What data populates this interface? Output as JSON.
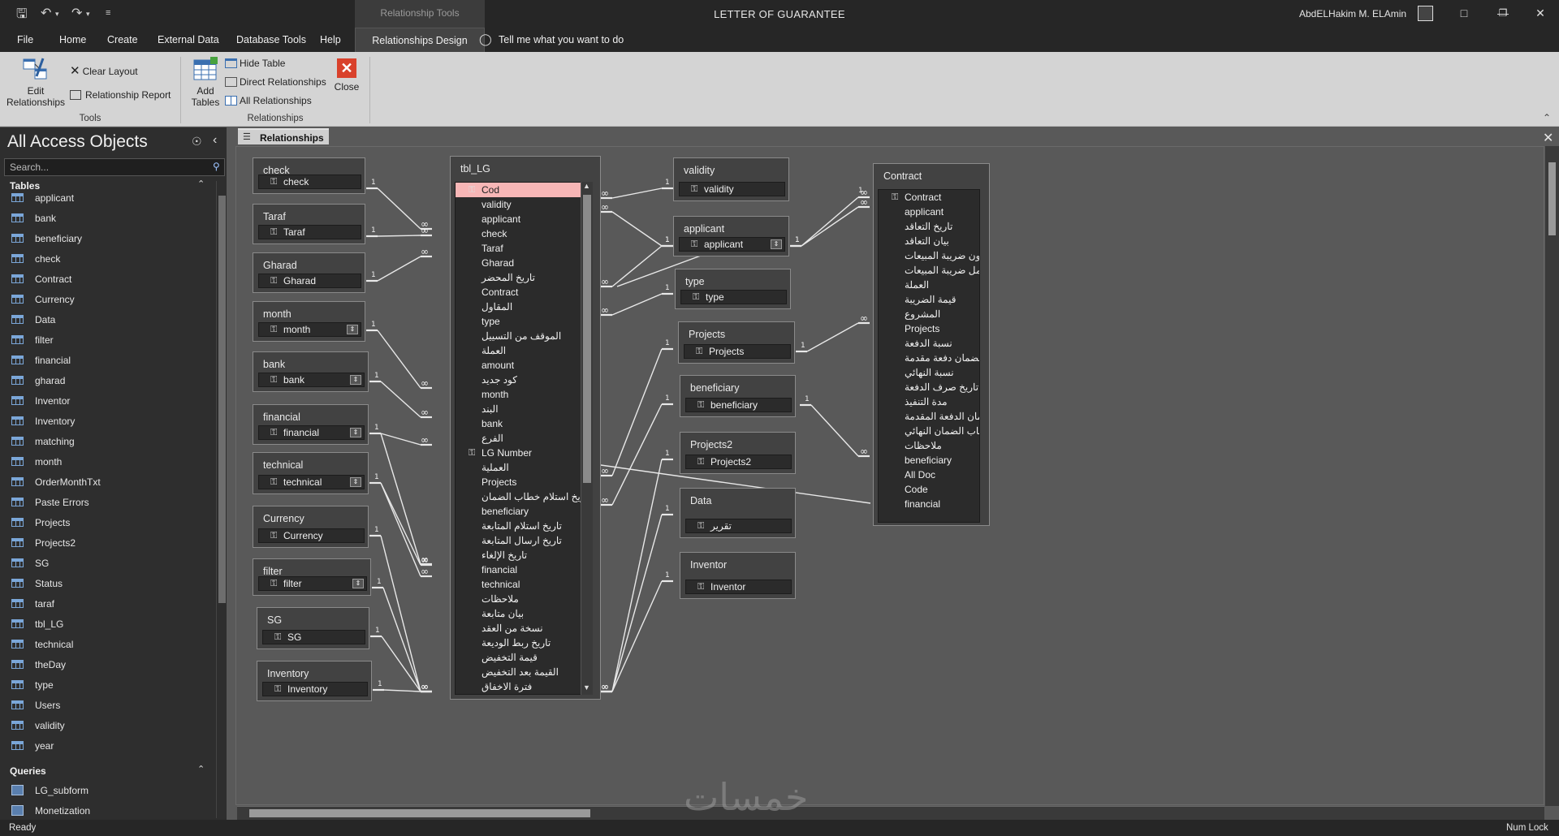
{
  "titlebar": {
    "context_tab": "Relationship Tools",
    "doc_title": "LETTER OF GUARANTEE",
    "user_name": "AbdELHakim M. ELAmin"
  },
  "ribbon_tabs": [
    "File",
    "Home",
    "Create",
    "External Data",
    "Database Tools",
    "Help",
    "Relationships Design"
  ],
  "tell_me": "Tell me what you want to do",
  "ribbon": {
    "edit_relationships_line1": "Edit",
    "edit_relationships_line2": "Relationships",
    "clear_layout": "Clear Layout",
    "relationship_report": "Relationship Report",
    "tools_group": "Tools",
    "add_tables_line1": "Add",
    "add_tables_line2": "Tables",
    "hide_table": "Hide Table",
    "direct_relationships": "Direct Relationships",
    "all_relationships": "All Relationships",
    "close": "Close",
    "relationships_group": "Relationships"
  },
  "nav": {
    "title": "All Access Objects",
    "search_placeholder": "Search...",
    "tables_header": "Tables",
    "tables": [
      "applicant",
      "bank",
      "beneficiary",
      "check",
      "Contract",
      "Currency",
      "Data",
      "filter",
      "financial",
      "gharad",
      "Inventor",
      "Inventory",
      "matching",
      "month",
      "OrderMonthTxt",
      "Paste Errors",
      "Projects",
      "Projects2",
      "SG",
      "Status",
      "taraf",
      "tbl_LG",
      "technical",
      "theDay",
      "type",
      "Users",
      "validity",
      "year"
    ],
    "queries_header": "Queries",
    "queries": [
      "LG_subform",
      "Monetization"
    ]
  },
  "doc_tab": "Relationships",
  "left_tables": [
    {
      "name": "check",
      "field": "check"
    },
    {
      "name": "Taraf",
      "field": "Taraf"
    },
    {
      "name": "Gharad",
      "field": "Gharad"
    },
    {
      "name": "month",
      "field": "month"
    },
    {
      "name": "bank",
      "field": "bank"
    },
    {
      "name": "financial",
      "field": "financial"
    },
    {
      "name": "technical",
      "field": "technical"
    },
    {
      "name": "Currency",
      "field": "Currency"
    },
    {
      "name": "filter",
      "field": "filter"
    },
    {
      "name": "SG",
      "field": "SG"
    },
    {
      "name": "Inventory",
      "field": "Inventory"
    }
  ],
  "tbl_lg": {
    "name": "tbl_LG",
    "fields": [
      "Cod",
      "validity",
      "applicant",
      "check",
      "Taraf",
      "Gharad",
      "تاريخ المحضر",
      "Contract",
      "المقاول",
      "type",
      "الموقف من التسييل",
      "العملة",
      "amount",
      "كود جديد",
      "month",
      "البند",
      "bank",
      "الفرع",
      "LG Number",
      "العملية",
      "Projects",
      "تاريخ استلام خطاب الضمان",
      "beneficiary",
      "تاريخ استلام المتابعة",
      "تاريخ ارسال المتابعة",
      "تاريخ الإلغاء",
      "financial",
      "technical",
      "ملاحظات",
      "بيان متابعة",
      "نسخة من العقد",
      "تاريخ ربط الوديعة",
      "قيمة التخفيض",
      "القيمة بعد التخفيض",
      "فترة الاخفاق"
    ]
  },
  "mid_tables": [
    {
      "name": "validity",
      "field": "validity"
    },
    {
      "name": "applicant",
      "field": "applicant"
    },
    {
      "name": "type",
      "field": "type"
    },
    {
      "name": "Projects",
      "field": "Projects"
    },
    {
      "name": "beneficiary",
      "field": "beneficiary"
    },
    {
      "name": "Projects2",
      "field": "Projects2"
    },
    {
      "name": "Data",
      "field": "تقرير"
    },
    {
      "name": "Inventor",
      "field": "Inventor"
    }
  ],
  "contract": {
    "name": "Contract",
    "fields": [
      "Contract",
      "applicant",
      "تاريخ التعاقد",
      "بيان التعاقد",
      "بدون ضريبة المبيعات )",
      "شامل ضريبة المبيعات )",
      "العملة",
      "قيمة الضريبة",
      "المشروع",
      "Projects",
      "نسبة الدفعة",
      "ب الضمان دفعة مقدمة",
      "نسبة النهائي",
      "تاريخ صرف الدفعة",
      "مدة التنفيذ",
      "لضمان الدفعة المقدمة",
      "خطاب الضمان النهائي",
      "ملاحظات",
      "beneficiary",
      "All Doc",
      "Code",
      "financial"
    ]
  },
  "rel_labels": {
    "one": "1",
    "many": "∞"
  },
  "status": {
    "left": "Ready",
    "right": "Num Lock"
  },
  "watermark": "خمسات"
}
